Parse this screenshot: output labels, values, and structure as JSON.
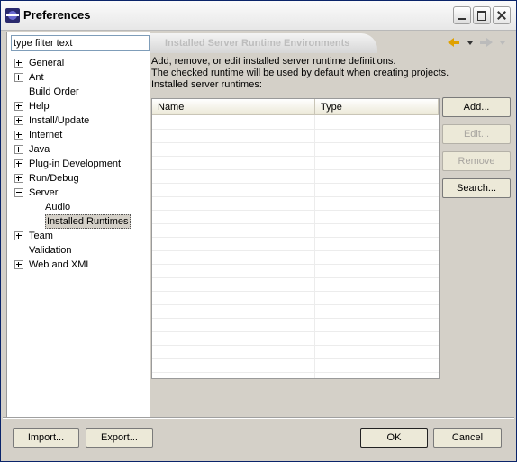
{
  "window": {
    "title": "Preferences"
  },
  "filter": {
    "value": "type filter text"
  },
  "tree": [
    {
      "label": "General",
      "expander": "plus",
      "depth": 0
    },
    {
      "label": "Ant",
      "expander": "plus",
      "depth": 0
    },
    {
      "label": "Build Order",
      "expander": "none",
      "depth": 0
    },
    {
      "label": "Help",
      "expander": "plus",
      "depth": 0
    },
    {
      "label": "Install/Update",
      "expander": "plus",
      "depth": 0
    },
    {
      "label": "Internet",
      "expander": "plus",
      "depth": 0
    },
    {
      "label": "Java",
      "expander": "plus",
      "depth": 0
    },
    {
      "label": "Plug-in Development",
      "expander": "plus",
      "depth": 0
    },
    {
      "label": "Run/Debug",
      "expander": "plus",
      "depth": 0
    },
    {
      "label": "Server",
      "expander": "minus",
      "depth": 0
    },
    {
      "label": "Audio",
      "expander": "none",
      "depth": 1
    },
    {
      "label": "Installed Runtimes",
      "expander": "none",
      "depth": 1,
      "selected": true
    },
    {
      "label": "Team",
      "expander": "plus",
      "depth": 0
    },
    {
      "label": "Validation",
      "expander": "none",
      "depth": 0
    },
    {
      "label": "Web and XML",
      "expander": "plus",
      "depth": 0
    }
  ],
  "page": {
    "title": "Installed Server Runtime Environments",
    "description": [
      "Add, remove, or edit installed server runtime definitions.",
      "The checked runtime will be used by default when creating projects.",
      "Installed server runtimes:"
    ]
  },
  "table": {
    "columns": [
      "Name",
      "Type"
    ],
    "rows": []
  },
  "side_buttons": [
    {
      "label": "Add...",
      "enabled": true
    },
    {
      "label": "Edit...",
      "enabled": false
    },
    {
      "label": "Remove",
      "enabled": false
    },
    {
      "label": "Search...",
      "enabled": true
    }
  ],
  "bottom_buttons": {
    "import": "Import...",
    "export": "Export...",
    "ok": "OK",
    "cancel": "Cancel"
  },
  "icons": {
    "app": "eclipse-icon",
    "back": "back-arrow-icon",
    "forward": "forward-arrow-icon",
    "back_color": "#e0a100",
    "forward_color": "#bbbbbb"
  }
}
